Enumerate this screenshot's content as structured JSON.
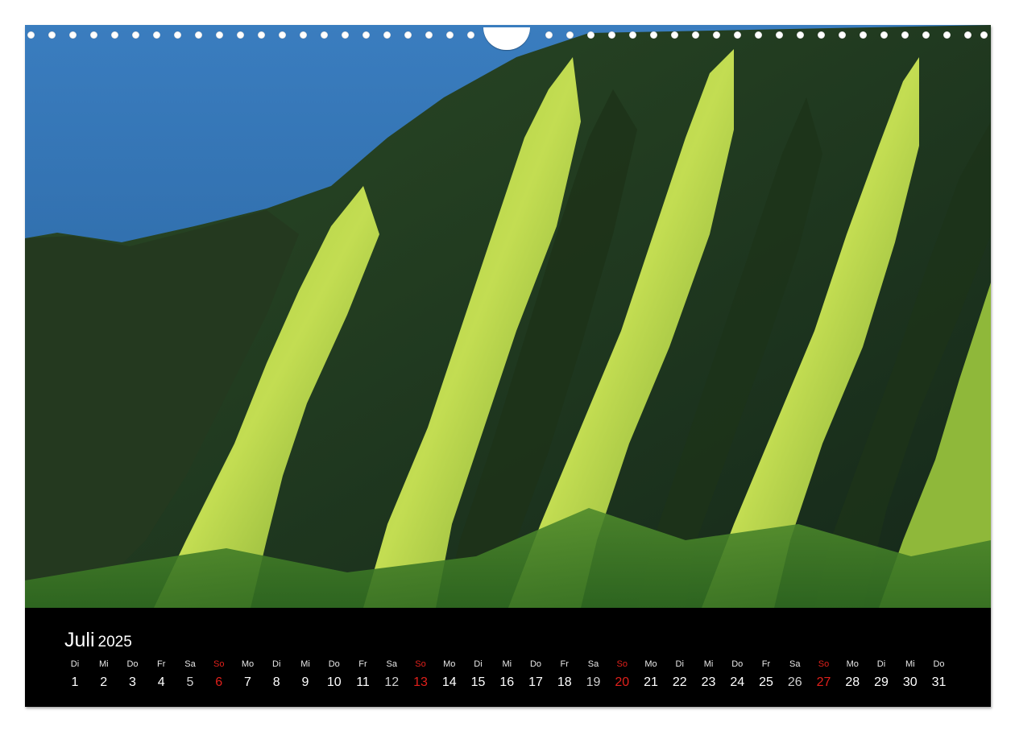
{
  "calendar": {
    "month": "Juli",
    "year": "2025",
    "days": [
      {
        "wd": "Di",
        "d": "1"
      },
      {
        "wd": "Mi",
        "d": "2"
      },
      {
        "wd": "Do",
        "d": "3"
      },
      {
        "wd": "Fr",
        "d": "4"
      },
      {
        "wd": "Sa",
        "d": "5"
      },
      {
        "wd": "So",
        "d": "6"
      },
      {
        "wd": "Mo",
        "d": "7"
      },
      {
        "wd": "Di",
        "d": "8"
      },
      {
        "wd": "Mi",
        "d": "9"
      },
      {
        "wd": "Do",
        "d": "10"
      },
      {
        "wd": "Fr",
        "d": "11"
      },
      {
        "wd": "Sa",
        "d": "12"
      },
      {
        "wd": "So",
        "d": "13"
      },
      {
        "wd": "Mo",
        "d": "14"
      },
      {
        "wd": "Di",
        "d": "15"
      },
      {
        "wd": "Mi",
        "d": "16"
      },
      {
        "wd": "Do",
        "d": "17"
      },
      {
        "wd": "Fr",
        "d": "18"
      },
      {
        "wd": "Sa",
        "d": "19"
      },
      {
        "wd": "So",
        "d": "20"
      },
      {
        "wd": "Mo",
        "d": "21"
      },
      {
        "wd": "Di",
        "d": "22"
      },
      {
        "wd": "Mi",
        "d": "23"
      },
      {
        "wd": "Do",
        "d": "24"
      },
      {
        "wd": "Fr",
        "d": "25"
      },
      {
        "wd": "Sa",
        "d": "26"
      },
      {
        "wd": "So",
        "d": "27"
      },
      {
        "wd": "Mo",
        "d": "28"
      },
      {
        "wd": "Di",
        "d": "29"
      },
      {
        "wd": "Mi",
        "d": "30"
      },
      {
        "wd": "Do",
        "d": "31"
      }
    ]
  },
  "colors": {
    "sunday": "#e0201b",
    "ocean": "#2f6fae",
    "ridge_light": "#b7d444",
    "ridge_dark": "#1f3a1c"
  },
  "photo": {
    "subject": "sea-cliff-ridges-photo"
  }
}
